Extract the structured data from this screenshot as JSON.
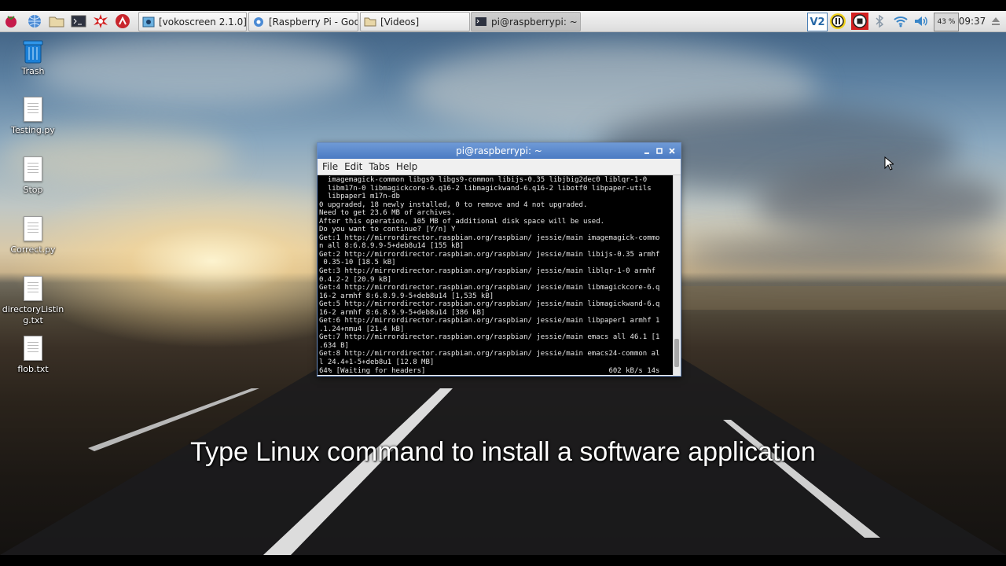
{
  "taskbar": {
    "launchers": [
      "raspberry-menu-icon",
      "web-browser-icon",
      "file-manager-icon",
      "terminal-icon",
      "burst-app-icon",
      "math-app-icon"
    ],
    "tasks": [
      {
        "label": "[vokoscreen 2.1.0]",
        "icon": "vokoscreen-icon"
      },
      {
        "label": "[Raspberry Pi - Googl...",
        "icon": "chromium-icon"
      },
      {
        "label": "[Videos]",
        "icon": "folder-icon"
      },
      {
        "label": "pi@raspberrypi: ~",
        "icon": "terminal-icon",
        "active": true
      }
    ],
    "tray": {
      "vnc_label": "V2",
      "cpu_label": "43 %",
      "clock": "09:37"
    }
  },
  "desktop_icons": [
    {
      "label": "Trash",
      "icon": "trash-icon"
    },
    {
      "label": "Testing.py",
      "icon": "file-icon"
    },
    {
      "label": "Stop",
      "icon": "file-icon"
    },
    {
      "label": "Correct.py",
      "icon": "file-icon"
    },
    {
      "label": "directoryListing.txt",
      "icon": "file-icon"
    },
    {
      "label": "flob.txt",
      "icon": "file-icon"
    }
  ],
  "terminal": {
    "title": "pi@raspberrypi: ~",
    "menu": [
      "File",
      "Edit",
      "Tabs",
      "Help"
    ],
    "lines": [
      "  imagemagick-common libgs9 libgs9-common libijs-0.35 libjbig2dec0 liblqr-1-0",
      "  libm17n-0 libmagickcore-6.q16-2 libmagickwand-6.q16-2 libotf0 libpaper-utils",
      "  libpaper1 m17n-db",
      "0 upgraded, 18 newly installed, 0 to remove and 4 not upgraded.",
      "Need to get 23.6 MB of archives.",
      "After this operation, 105 MB of additional disk space will be used.",
      "Do you want to continue? [Y/n] Y",
      "Get:1 http://mirrordirector.raspbian.org/raspbian/ jessie/main imagemagick-commo",
      "n all 8:6.8.9.9-5+deb8u14 [155 kB]",
      "Get:2 http://mirrordirector.raspbian.org/raspbian/ jessie/main libijs-0.35 armhf",
      " 0.35-10 [18.5 kB]",
      "Get:3 http://mirrordirector.raspbian.org/raspbian/ jessie/main liblqr-1-0 armhf",
      "0.4.2-2 [20.9 kB]",
      "Get:4 http://mirrordirector.raspbian.org/raspbian/ jessie/main libmagickcore-6.q",
      "16-2 armhf 8:6.8.9.9-5+deb8u14 [1,535 kB]",
      "Get:5 http://mirrordirector.raspbian.org/raspbian/ jessie/main libmagickwand-6.q",
      "16-2 armhf 8:6.8.9.9-5+deb8u14 [386 kB]",
      "Get:6 http://mirrordirector.raspbian.org/raspbian/ jessie/main libpaper1 armhf 1",
      ".1.24+nmu4 [21.4 kB]",
      "Get:7 http://mirrordirector.raspbian.org/raspbian/ jessie/main emacs all 46.1 [1",
      ".634 B]",
      "Get:8 http://mirrordirector.raspbian.org/raspbian/ jessie/main emacs24-common al",
      "l 24.4+1-5+deb8u1 [12.8 MB]",
      "64% [Waiting for headers]                                           602 kB/s 14s"
    ]
  },
  "caption": "Type Linux command to install a software application"
}
